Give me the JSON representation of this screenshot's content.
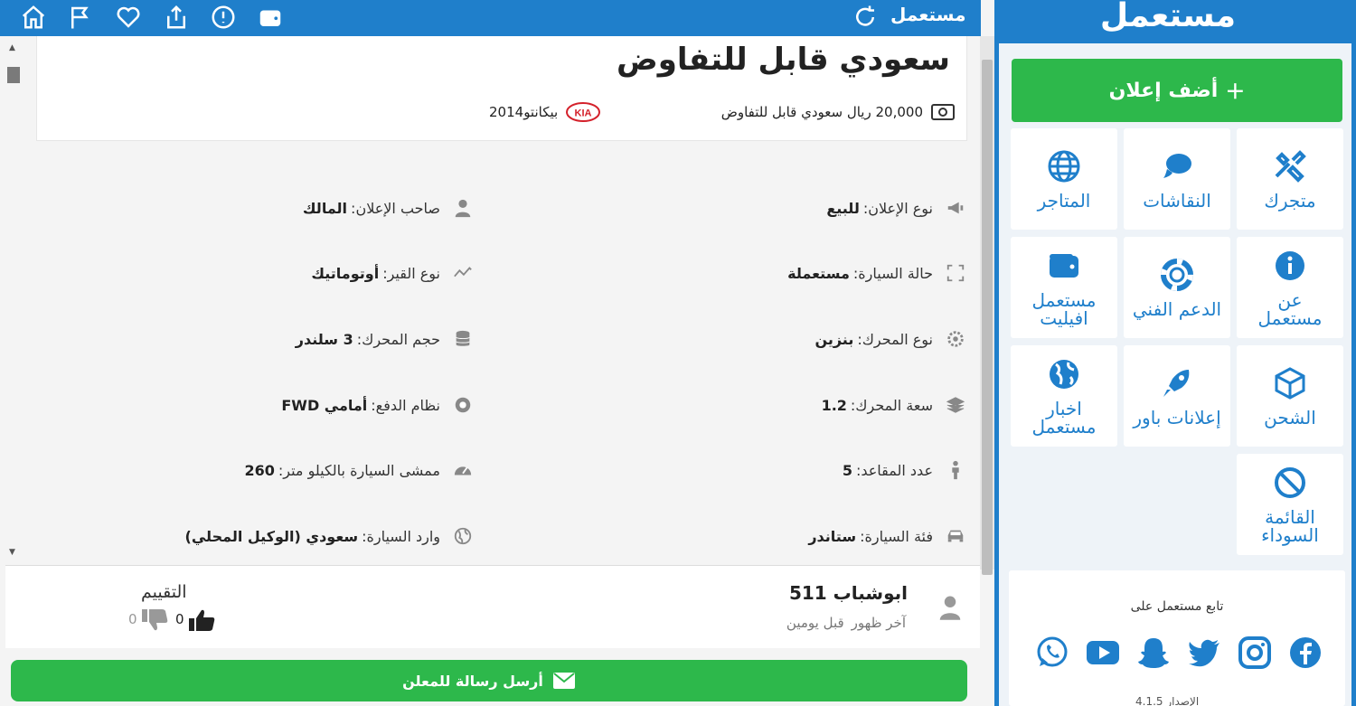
{
  "topbar": {
    "logo_text": "مستعمل",
    "icons": [
      "home-icon",
      "flag-icon",
      "heart-icon",
      "share-icon",
      "report-icon",
      "wallet-icon",
      "refresh-icon"
    ]
  },
  "ad": {
    "title": "سعودي قابل للتفاوض",
    "price": "20,000 ريال سعودي قابل للتفاوض",
    "brand_logo": "KIA",
    "model": "بيكانتو2014"
  },
  "details": [
    {
      "label": "نوع الإعلان:",
      "value": "للبيع",
      "icon": "megaphone-icon"
    },
    {
      "label": "صاحب الإعلان:",
      "value": "المالك",
      "icon": "user-icon"
    },
    {
      "label": "حالة السيارة:",
      "value": "مستعملة",
      "icon": "expand-icon"
    },
    {
      "label": "نوع القير:",
      "value": "أوتوماتيك",
      "icon": "chart-line-icon"
    },
    {
      "label": "نوع المحرك:",
      "value": "بنزين",
      "icon": "gear-icon"
    },
    {
      "label": "حجم المحرك:",
      "value": "3 سلندر",
      "icon": "database-icon"
    },
    {
      "label": "سعة المحرك:",
      "value": "1.2",
      "icon": "layers-icon"
    },
    {
      "label": "نظام الدفع:",
      "value": "أمامي FWD",
      "icon": "circle-gear-icon"
    },
    {
      "label": "عدد المقاعد:",
      "value": "5",
      "icon": "person-icon"
    },
    {
      "label": "ممشى السيارة بالكيلو متر:",
      "value": "260",
      "icon": "speedometer-icon"
    },
    {
      "label": "فئة السيارة:",
      "value": "ستاندر",
      "icon": "car-icon"
    },
    {
      "label": "وارد السيارة:",
      "value": "سعودي (الوكيل المحلي)",
      "icon": "globe-icon"
    }
  ],
  "seller": {
    "name": "ابوشباب 511",
    "last_seen_label": "آخر ظهور",
    "last_seen_value": "قبل يومين",
    "rating_label": "التقييم",
    "likes": "0",
    "dislikes": "0"
  },
  "send_button": "أرسل رسالة للمعلن",
  "sidebar": {
    "logo_text": "مستعمل",
    "add_ad": "أضف إعلان",
    "tiles": [
      {
        "label": "متجرك",
        "icon": "tools-icon"
      },
      {
        "label": "النقاشات",
        "icon": "chat-icon"
      },
      {
        "label": "المتاجر",
        "icon": "globe-icon"
      },
      {
        "label": "عن مستعمل",
        "icon": "info-icon"
      },
      {
        "label": "الدعم الفني",
        "icon": "lifebuoy-icon"
      },
      {
        "label": "مستعمل افيليت",
        "icon": "wallet-icon"
      },
      {
        "label": "الشحن",
        "icon": "box-icon"
      },
      {
        "label": "إعلانات باور",
        "icon": "rocket-icon"
      },
      {
        "label": "اخبار مستعمل",
        "icon": "earth-icon"
      },
      {
        "label": "القائمة السوداء",
        "icon": "ban-icon"
      }
    ],
    "follow_label": "تابع مستعمل على",
    "socials": [
      "facebook-icon",
      "instagram-icon",
      "twitter-icon",
      "snapchat-icon",
      "youtube-icon",
      "whatsapp-icon"
    ],
    "version_text": "الإصدار 4.1.5"
  },
  "colors": {
    "primary": "#1f7fcb",
    "green": "#2db84b",
    "kia_red": "#d4202a"
  }
}
